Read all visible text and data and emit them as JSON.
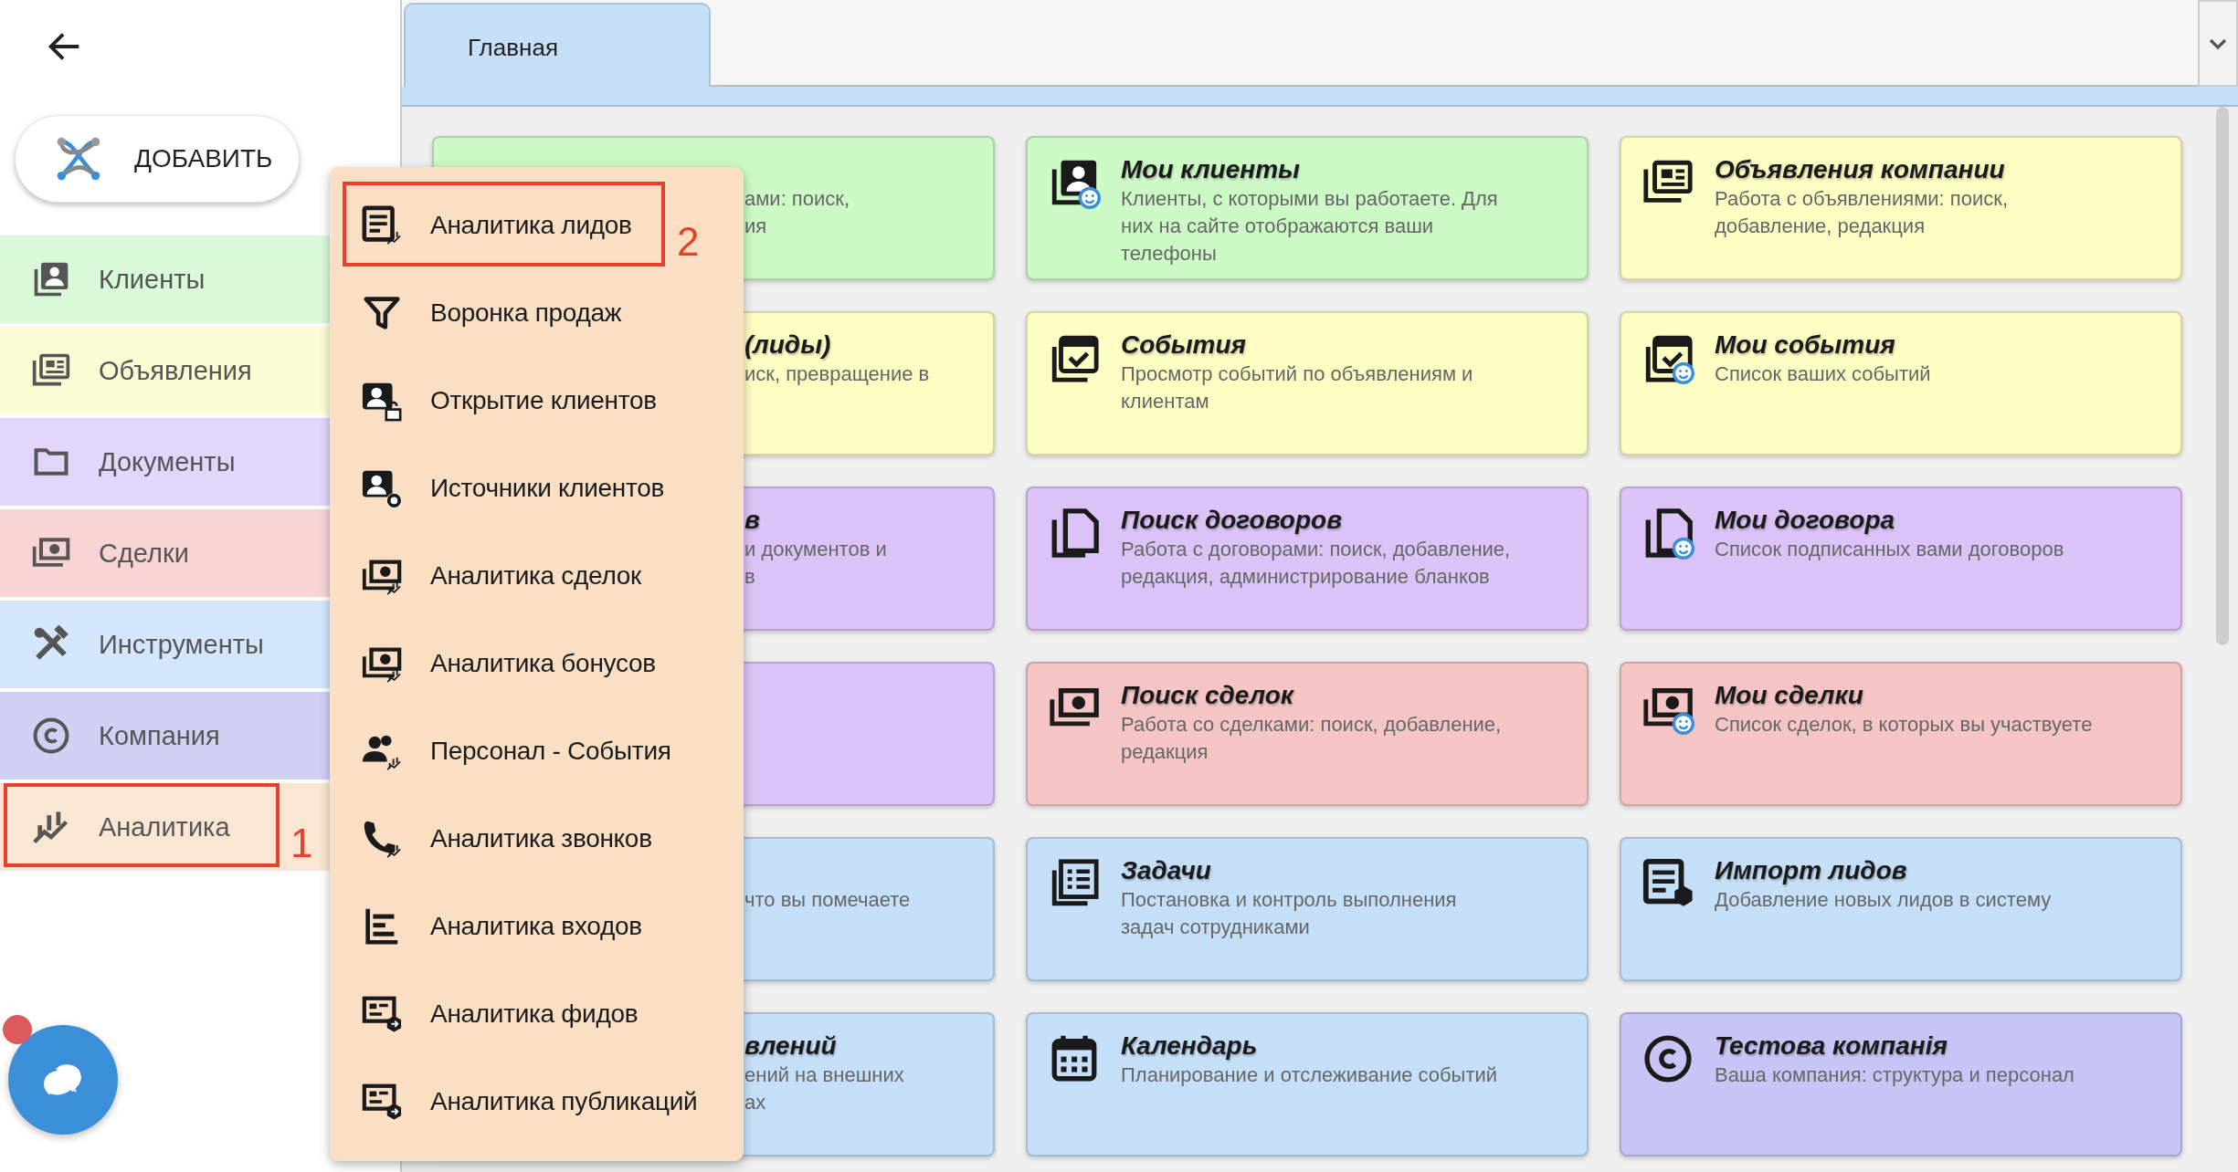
{
  "add_button": {
    "label": "ДОБАВИТЬ"
  },
  "sidebar": {
    "items": [
      {
        "label": "Клиенты",
        "color": "#d9f9d9"
      },
      {
        "label": "Объявления",
        "color": "#fdfdd5"
      },
      {
        "label": "Документы",
        "color": "#e3d5fb"
      },
      {
        "label": "Сделки",
        "color": "#f8d4d4"
      },
      {
        "label": "Инструменты",
        "color": "#d4e6fb"
      },
      {
        "label": "Компания",
        "color": "#d0d0f5"
      },
      {
        "label": "Аналитика",
        "color": "#fbe6d4",
        "annotation": "1"
      }
    ]
  },
  "tabs": [
    {
      "label": "Главная"
    }
  ],
  "card_rows": [
    {
      "cards": [
        {
          "color": "#ccf9c6",
          "covered": true,
          "description": [
            "ами: поиск,",
            "ия"
          ]
        },
        {
          "color": "#ccf9c6",
          "title": "Мои клиенты",
          "description": [
            "Клиенты, с которыми вы работаете. Для",
            "них на сайте отображаются ваши",
            "телефоны"
          ]
        },
        {
          "color": "#fefdc4",
          "title": "Объявления компании",
          "description": [
            "Работа с объявлениями: поиск,",
            "добавление, редакция"
          ]
        }
      ]
    },
    {
      "cards": [
        {
          "color": "#fefdc4",
          "covered": true,
          "title": "(лиды)",
          "description": [
            "иск, превращение в"
          ]
        },
        {
          "color": "#fefdc4",
          "title": "События",
          "description": [
            "Просмотр событий по объявлениям и",
            "клиентам"
          ]
        },
        {
          "color": "#fefdc4",
          "title": "Мои события",
          "description": [
            "Список ваших событий"
          ]
        }
      ]
    },
    {
      "cards": [
        {
          "color": "#dbc3f7",
          "covered": true,
          "title": "в",
          "description": [
            "и документов и",
            "в"
          ]
        },
        {
          "color": "#dbc3f7",
          "title": "Поиск договоров",
          "description": [
            "Работа с договорами: поиск, добавление,",
            "редакция, администрирование бланков"
          ]
        },
        {
          "color": "#dbc3f7",
          "title": "Мои договора",
          "description": [
            "Список подписанных вами договоров"
          ]
        }
      ]
    },
    {
      "cards": [
        {
          "color": "#dbc3f7",
          "covered": true
        },
        {
          "color": "#f5c5c5",
          "title": "Поиск сделок",
          "description": [
            "Работа со сделками: поиск, добавление,",
            "редакция"
          ]
        },
        {
          "color": "#f5c5c5",
          "title": "Мои сделки",
          "description": [
            "Список сделок, в которых вы участвуете"
          ]
        }
      ]
    },
    {
      "cards": [
        {
          "color": "#c5dff9",
          "covered": true,
          "description": [
            "что вы помечаете"
          ]
        },
        {
          "color": "#c5dff9",
          "title": "Задачи",
          "description": [
            "Постановка и контроль выполнения",
            "задач сотрудниками"
          ]
        },
        {
          "color": "#c5dff9",
          "title": "Импорт лидов",
          "description": [
            "Добавление новых лидов в систему"
          ]
        }
      ]
    },
    {
      "cards": [
        {
          "color": "#c5dff9",
          "covered": true,
          "title": "влений",
          "description": [
            "ений на внешних",
            "ах"
          ]
        },
        {
          "color": "#c5dff9",
          "title": "Календарь",
          "description": [
            "Планирование и отслеживание событий"
          ]
        },
        {
          "color": "#c7c5f6",
          "title": "Тестова компанія",
          "description": [
            "Ваша компания: структура и персонал"
          ]
        }
      ]
    }
  ],
  "menu": {
    "items": [
      {
        "label": "Аналитика лидов",
        "annotation": "2"
      },
      {
        "label": "Воронка продаж"
      },
      {
        "label": "Открытие клиентов"
      },
      {
        "label": "Источники клиентов"
      },
      {
        "label": "Аналитика сделок"
      },
      {
        "label": "Аналитика бонусов"
      },
      {
        "label": "Персонал - События"
      },
      {
        "label": "Аналитика звонков"
      },
      {
        "label": "Аналитика входов"
      },
      {
        "label": "Аналитика фидов"
      },
      {
        "label": "Аналитика публикаций"
      }
    ]
  },
  "chat": {
    "unread": true
  }
}
